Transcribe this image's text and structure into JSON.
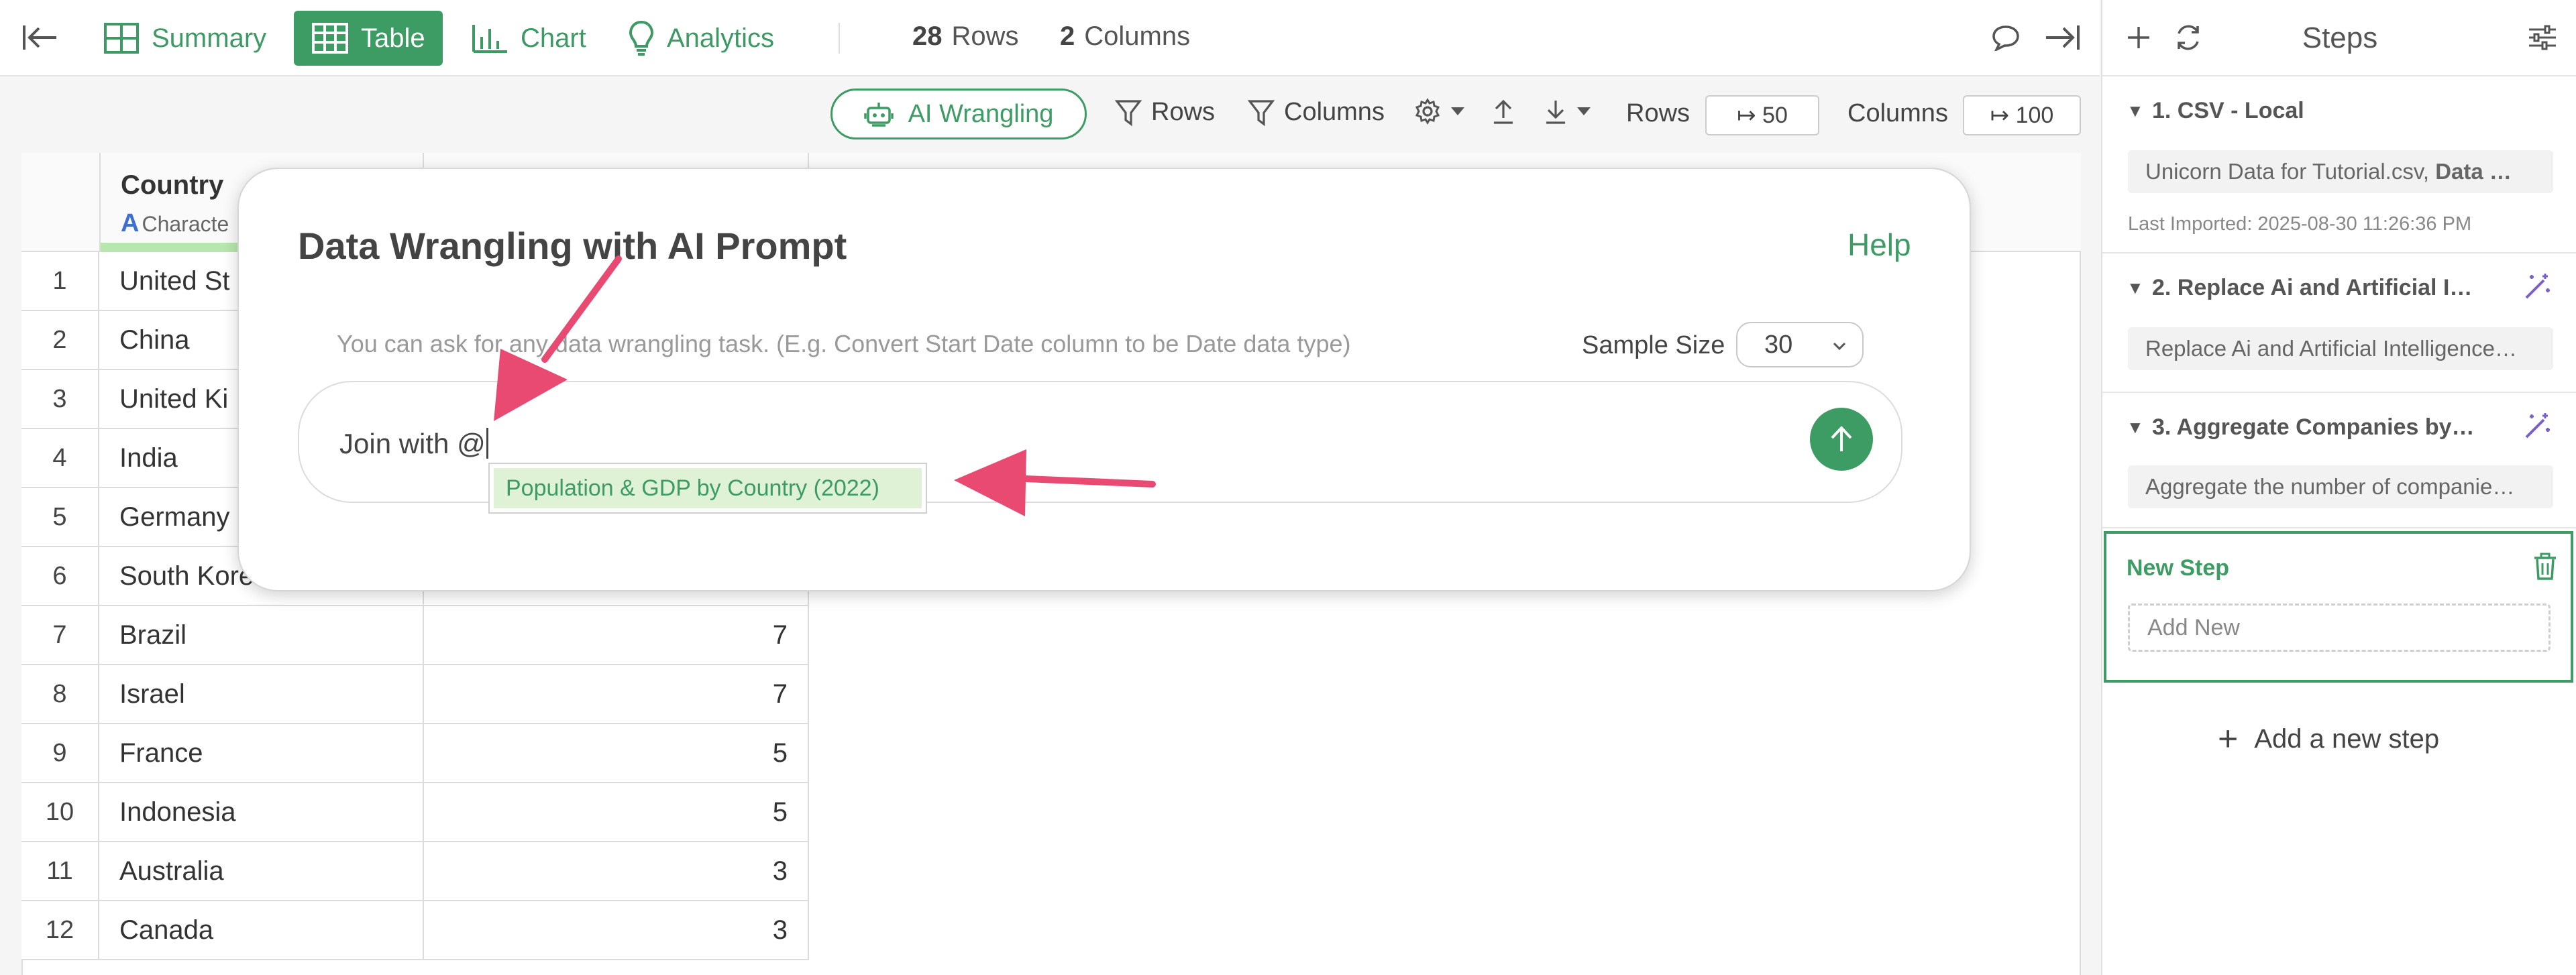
{
  "toolbar": {
    "tabs": [
      {
        "label": "Summary"
      },
      {
        "label": "Table"
      },
      {
        "label": "Chart"
      },
      {
        "label": "Analytics"
      }
    ],
    "row_count": "28",
    "row_label": "Rows",
    "col_count": "2",
    "col_label": "Columns"
  },
  "subtoolbar": {
    "ai_label": "AI Wrangling",
    "filter_rows": "Rows",
    "filter_columns": "Columns",
    "rows_label": "Rows",
    "rows_limit": "↦ 50",
    "cols_label": "Columns",
    "cols_limit": "↦ 100"
  },
  "table": {
    "column_name": "Country",
    "column_type": "Characte",
    "column_type_glyph": "A",
    "rows": [
      {
        "n": "1",
        "country": "United St",
        "count": ""
      },
      {
        "n": "2",
        "country": "China",
        "count": ""
      },
      {
        "n": "3",
        "country": "United Ki",
        "count": ""
      },
      {
        "n": "4",
        "country": "India",
        "count": ""
      },
      {
        "n": "5",
        "country": "Germany",
        "count": ""
      },
      {
        "n": "6",
        "country": "South Kore",
        "count": ""
      },
      {
        "n": "7",
        "country": "Brazil",
        "count": "7"
      },
      {
        "n": "8",
        "country": "Israel",
        "count": "7"
      },
      {
        "n": "9",
        "country": "France",
        "count": "5"
      },
      {
        "n": "10",
        "country": "Indonesia",
        "count": "5"
      },
      {
        "n": "11",
        "country": "Australia",
        "count": "3"
      },
      {
        "n": "12",
        "country": "Canada",
        "count": "3"
      }
    ]
  },
  "modal": {
    "title": "Data Wrangling with AI Prompt",
    "help": "Help",
    "hint": "You can ask for any data wrangling task. (E.g. Convert Start Date column to be Date data type)",
    "sample_label": "Sample Size",
    "sample_value": "30",
    "prompt_value": "Join with @",
    "suggestion": "Population & GDP by Country (2022)"
  },
  "steps": {
    "title": "Steps",
    "items": [
      {
        "title": "1. CSV - Local",
        "desc_plain": "Unicorn Data for Tutorial.csv, ",
        "desc_bold": "Data …",
        "meta": "Last Imported: 2025-08-30 11:26:36 PM"
      },
      {
        "title": "2. Replace Ai and Artificial I…",
        "desc": "Replace Ai and Artificial Intelligence…"
      },
      {
        "title": "3. Aggregate Companies by…",
        "desc": "Aggregate the number of companie…"
      }
    ],
    "new_step_label": "New Step",
    "add_new_placeholder": "Add New",
    "add_step_label": "Add a new step"
  },
  "colors": {
    "brand": "#3d9c63",
    "arrow": "#e84a72",
    "type_badge": "#3b6fd1"
  }
}
